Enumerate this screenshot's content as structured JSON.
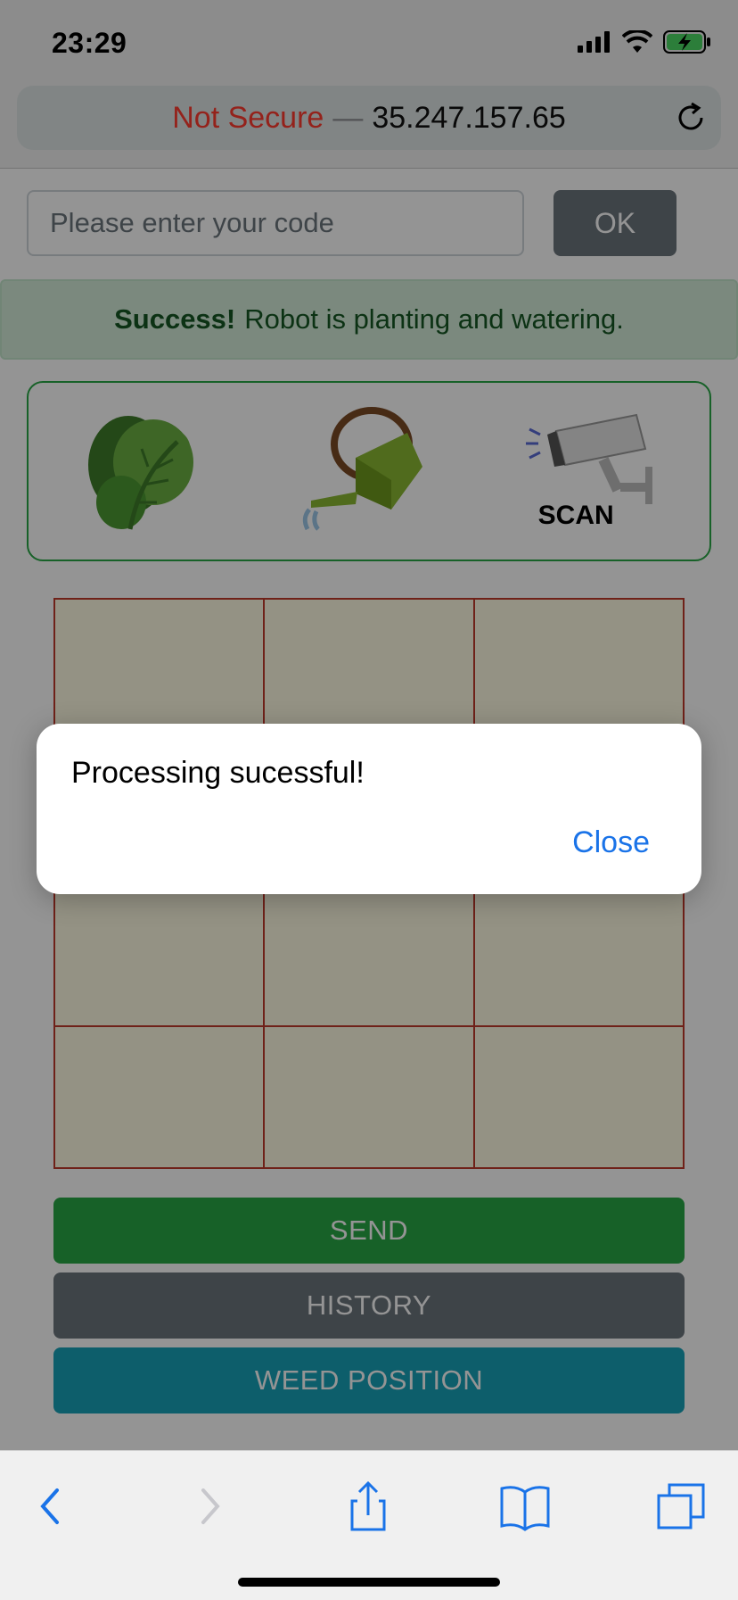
{
  "status_bar": {
    "time": "23:29"
  },
  "browser": {
    "url_security": "Not Secure",
    "url_separator": "—",
    "url_host": "35.247.157.65"
  },
  "form": {
    "code_placeholder": "Please enter your code",
    "ok_label": "OK"
  },
  "alert": {
    "strong": "Success!",
    "message": "Robot is planting and watering."
  },
  "tools": {
    "scan_label": "SCAN"
  },
  "buttons": {
    "send": "SEND",
    "history": "HISTORY",
    "weed_position": "WEED POSITION"
  },
  "dialog": {
    "message": "Processing sucessful!",
    "close_label": "Close"
  },
  "colors": {
    "success_green": "#28a745",
    "secondary_gray": "#6c757d",
    "info_teal": "#17a2b8",
    "link_blue": "#1a73e8",
    "insecure_red": "#ff3b30"
  }
}
